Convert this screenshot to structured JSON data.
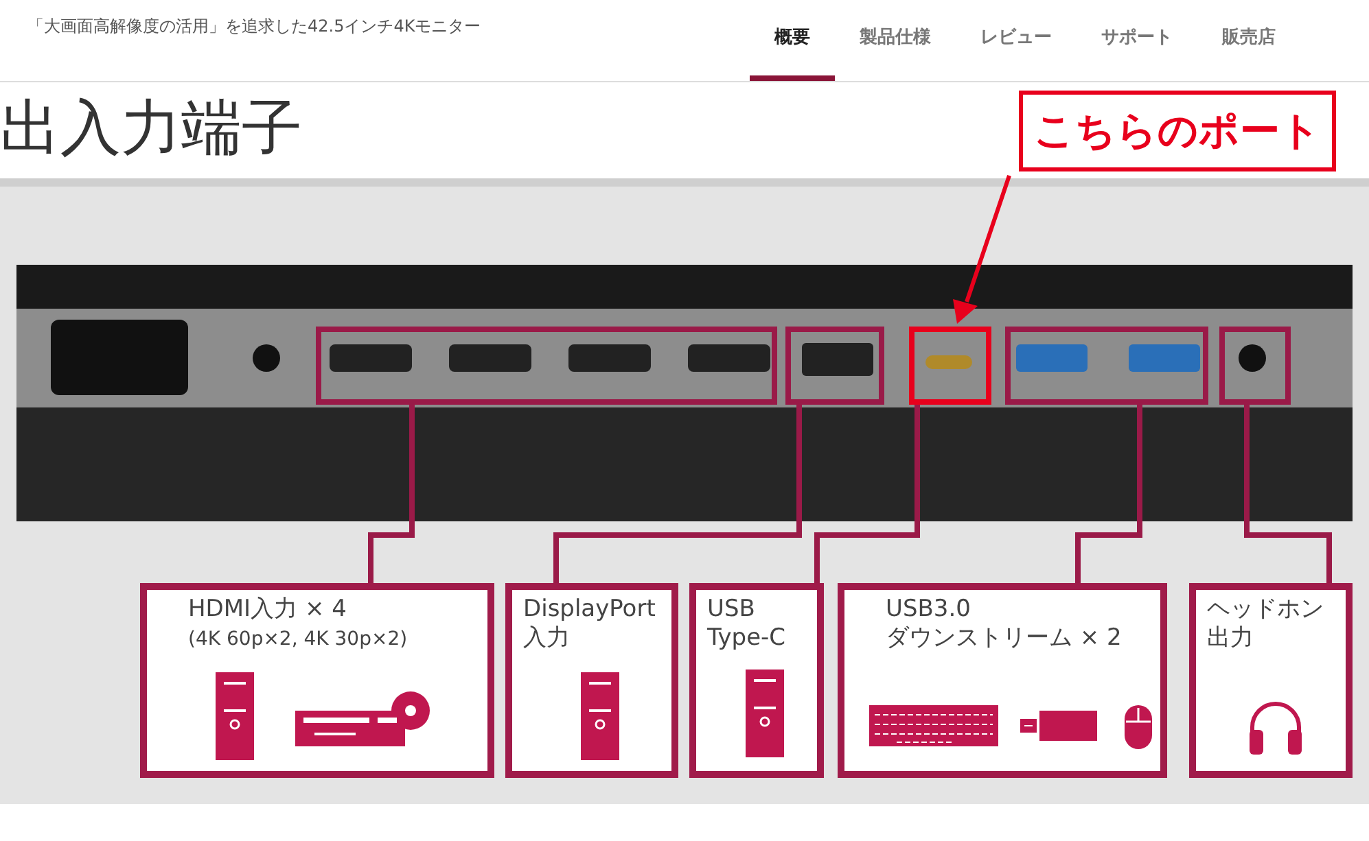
{
  "header": {
    "title": "「大画面高解像度の活用」を追求した42.5インチ4Kモニター"
  },
  "nav": [
    {
      "label": "概要",
      "selected": true
    },
    {
      "label": "製品仕様",
      "selected": false
    },
    {
      "label": "レビュー",
      "selected": false
    },
    {
      "label": "サポート",
      "selected": false
    },
    {
      "label": "販売店",
      "selected": false
    }
  ],
  "section_title": "出入力端子",
  "callout": "こちらのポート",
  "port_groups": [
    {
      "highlighted": false
    },
    {
      "highlighted": false
    },
    {
      "highlighted": true
    },
    {
      "highlighted": false
    },
    {
      "highlighted": false
    }
  ],
  "boxes": [
    {
      "lines": [
        "HDMI入力 × 4"
      ],
      "note": "(4K 60p×2, 4K 30p×2)",
      "devices": [
        {
          "kind": "pc"
        },
        {
          "kind": "player"
        }
      ]
    },
    {
      "lines": [
        "DisplayPort",
        "入力"
      ],
      "devices": [
        {
          "kind": "pc"
        }
      ]
    },
    {
      "lines": [
        "USB",
        "Type-C"
      ],
      "devices": [
        {
          "kind": "pc"
        }
      ]
    },
    {
      "lines": [
        "USB3.0",
        "ダウンストリーム × 2"
      ],
      "devices": [
        {
          "kind": "keyboard"
        },
        {
          "kind": "dongle"
        },
        {
          "kind": "mouse"
        }
      ]
    },
    {
      "lines": [
        "ヘッドホン",
        "出力"
      ],
      "devices": [
        {
          "kind": "headphones"
        }
      ]
    }
  ]
}
